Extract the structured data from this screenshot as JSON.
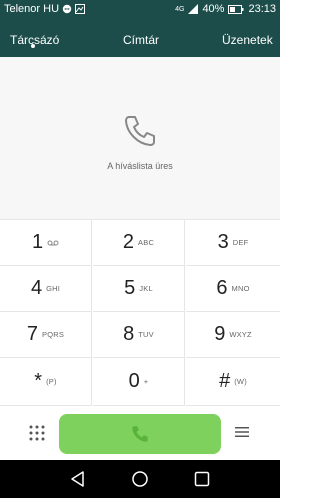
{
  "status": {
    "carrier": "Telenor HU",
    "signal": "4G",
    "battery": "40%",
    "time": "23:13"
  },
  "tabs": [
    {
      "label": "Tárcsázó"
    },
    {
      "label": "Címtár"
    },
    {
      "label": "Üzenetek"
    }
  ],
  "empty_state": {
    "text": "A híváslista üres",
    "icon": "phone-icon"
  },
  "keypad": {
    "keys": [
      {
        "digit": "1",
        "sub": "voicemail-icon"
      },
      {
        "digit": "2",
        "sub": "ABC"
      },
      {
        "digit": "3",
        "sub": "DEF"
      },
      {
        "digit": "4",
        "sub": "GHI"
      },
      {
        "digit": "5",
        "sub": "JKL"
      },
      {
        "digit": "6",
        "sub": "MNO"
      },
      {
        "digit": "7",
        "sub": "PQRS"
      },
      {
        "digit": "8",
        "sub": "TUV"
      },
      {
        "digit": "9",
        "sub": "WXYZ"
      },
      {
        "digit": "*",
        "sub": "(P)"
      },
      {
        "digit": "0",
        "sub": "+"
      },
      {
        "digit": "#",
        "sub": "(W)"
      }
    ]
  },
  "colors": {
    "header": "#1d4d4a",
    "call": "#7ed15c",
    "navbar": "#000000"
  }
}
